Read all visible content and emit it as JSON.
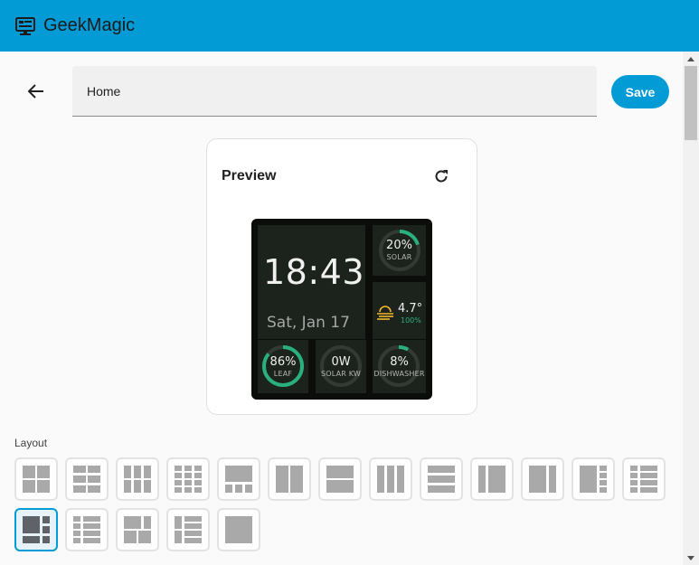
{
  "app": {
    "title": "GeekMagic",
    "icon": "monitor-icon"
  },
  "colors": {
    "accent": "#039bd5",
    "ring_green": "#2ab07f",
    "weather_icon": "#f0b72e"
  },
  "editor": {
    "name_value": "Home",
    "save_label": "Save"
  },
  "preview": {
    "title": "Preview",
    "screen": {
      "clock": {
        "time": "18:43",
        "date": "Sat, Jan 17"
      },
      "solar": {
        "value": "20%",
        "label": "SOLAR",
        "level": 0.2
      },
      "weather": {
        "temp": "4.7°",
        "humidity": "100%",
        "icon": "fog-sun-icon"
      },
      "leaf": {
        "value": "86%",
        "label": "LEAF",
        "level": 0.86
      },
      "solar_kw": {
        "value": "0W",
        "label": "SOLAR KW",
        "level": 0
      },
      "dishwasher": {
        "value": "8%",
        "label": "DISHWASHER",
        "level": 0.08
      }
    }
  },
  "layout": {
    "label": "Layout",
    "options": [
      {
        "id": "grid-2x2",
        "selected": false
      },
      {
        "id": "grid-2x3",
        "selected": false
      },
      {
        "id": "grid-3x3",
        "selected": false
      },
      {
        "id": "grid-3x4",
        "selected": false
      },
      {
        "id": "hero-bottom-3",
        "selected": false
      },
      {
        "id": "split-vertical-2",
        "selected": false
      },
      {
        "id": "split-horizontal-2",
        "selected": false
      },
      {
        "id": "columns-3",
        "selected": false
      },
      {
        "id": "rows-3",
        "selected": false
      },
      {
        "id": "sidebar-left",
        "selected": false
      },
      {
        "id": "sidebar-right",
        "selected": false
      },
      {
        "id": "main-left-list-right",
        "selected": false
      },
      {
        "id": "list-left-main-right",
        "selected": false
      },
      {
        "id": "hero-grid",
        "selected": true
      },
      {
        "id": "list-left-rows-right",
        "selected": false
      },
      {
        "id": "hero-top-grid",
        "selected": false
      },
      {
        "id": "list-grid",
        "selected": false
      },
      {
        "id": "fullscreen",
        "selected": false
      }
    ]
  }
}
